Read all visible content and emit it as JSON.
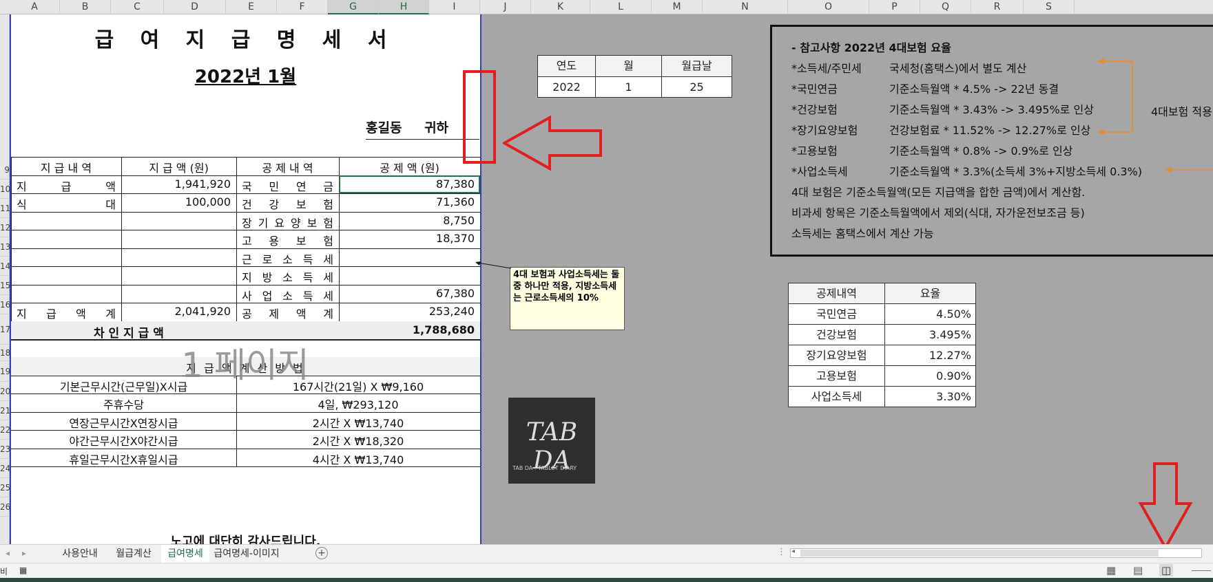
{
  "columns": [
    "A",
    "B",
    "C",
    "D",
    "E",
    "F",
    "G",
    "H",
    "I",
    "J",
    "K",
    "L",
    "M",
    "N",
    "O",
    "P",
    "Q",
    "R",
    "S"
  ],
  "rows": [
    "9",
    "10",
    "11",
    "12",
    "13",
    "14",
    "15",
    "16",
    "17",
    "18",
    "19",
    "20",
    "21",
    "22",
    "23",
    "24",
    "25",
    "26"
  ],
  "payslip": {
    "title": "급 여 지 급 명 세 서",
    "period": "2022년 1월",
    "recipient": "홍길동",
    "honorific": "귀하",
    "headers": [
      "지 급 내 역",
      "지 급 액 (원)",
      "공 제 내 역",
      "공 제 액 (원)"
    ],
    "pay_items": [
      {
        "label_chars": [
          "지",
          "급",
          "액"
        ],
        "amount": "1,941,920"
      },
      {
        "label_chars": [
          "식",
          "대"
        ],
        "amount": "100,000"
      }
    ],
    "deductions": [
      {
        "label_chars": [
          "국",
          "민",
          "연",
          "금"
        ],
        "amount": "87,380"
      },
      {
        "label_chars": [
          "건",
          "강",
          "보",
          "험"
        ],
        "amount": "71,360"
      },
      {
        "label_chars": [
          "장",
          "기",
          "요",
          "양",
          "보",
          "험"
        ],
        "amount": "8,750"
      },
      {
        "label_chars": [
          "고",
          "용",
          "보",
          "험"
        ],
        "amount": "18,370"
      },
      {
        "label_chars": [
          "근",
          "로",
          "소",
          "득",
          "세"
        ],
        "amount": ""
      },
      {
        "label_chars": [
          "지",
          "방",
          "소",
          "득",
          "세"
        ],
        "amount": ""
      },
      {
        "label_chars": [
          "사",
          "업",
          "소",
          "득",
          "세"
        ],
        "amount": "67,380"
      }
    ],
    "total_pay_label_chars": [
      "지",
      "급",
      "액",
      "계"
    ],
    "total_pay": "2,041,920",
    "total_deduction_label_chars": [
      "공",
      "제",
      "액",
      "계"
    ],
    "total_deduction": "253,240",
    "net_label": "차 인 지 급 액",
    "net_amount": "1,788,680",
    "watermark": "1 페이지",
    "calc_title": "지 급 액 계 산 방 법",
    "calc_rows": [
      {
        "label": "기본근무시간(근무일)X시급",
        "value": "167시간(21일) X ₩9,160"
      },
      {
        "label": "주휴수당",
        "value": "4일, ₩293,120"
      },
      {
        "label": "연장근무시간X연장시급",
        "value": "2시간 X ₩13,740"
      },
      {
        "label": "야간근무시간X야간시급",
        "value": "2시간 X ₩18,320"
      },
      {
        "label": "휴일근무시간X휴일시급",
        "value": "4시간 X ₩13,740"
      }
    ],
    "footer": "노고에 대단히 감사드립니다."
  },
  "date_table": {
    "headers": [
      "연도",
      "월",
      "월급날"
    ],
    "values": [
      "2022",
      "1",
      "25"
    ]
  },
  "comment": "4대 보험과 사업소득세는 둘 중 하나만 적용, 지방소득세는 근로소득세의 10%",
  "logo": {
    "text": "TAB DA",
    "subtext": "TAB DA : TABLET DIARY"
  },
  "notes": {
    "title": "- 참고사항 2022년 4대보험 요율",
    "lines": [
      {
        "label": "*소득세/주민세",
        "text": "국세청(홈택스)에서 별도 계산"
      },
      {
        "label": "*국민연금",
        "text": "기준소득월액 * 4.5% -> 22년 동결"
      },
      {
        "label": "*건강보험",
        "text": "기준소득월액 * 3.43% -> 3.495%로 인상"
      },
      {
        "label": "*장기요양보험",
        "text": "건강보험료 * 11.52% -> 12.27%로 인상"
      },
      {
        "label": "*고용보험",
        "text": "기준소득월액 * 0.8% -> 0.9%로 인상"
      },
      {
        "label": "*사업소득세",
        "text": "기준소득월액 * 3.3%(소득세 3%+지방소득세 0.3%)"
      }
    ],
    "plain_lines": [
      "4대 보험은 기준소득월액(모든 지급액을 합한 금액)에서 계산함.",
      "비과세 항목은 기준소득월액에서 제외(식대, 자가운전보조금 등)",
      "소득세는 홈택스에서 계산 가능"
    ],
    "side_note": "4대보험 적용"
  },
  "rate_table": {
    "headers": [
      "공제내역",
      "요율"
    ],
    "rows": [
      {
        "name": "국민연금",
        "rate": "4.50%"
      },
      {
        "name": "건강보험",
        "rate": "3.495%"
      },
      {
        "name": "장기요양보험",
        "rate": "12.27%"
      },
      {
        "name": "고용보험",
        "rate": "0.90%"
      },
      {
        "name": "사업소득세",
        "rate": "3.30%"
      }
    ]
  },
  "sheet_tabs": [
    "사용안내",
    "월급계산",
    "급여명세",
    "급여명세-이미지"
  ],
  "active_tab": "급여명세",
  "colors": {
    "accent_red": "#e02020",
    "excel_green": "#217346",
    "page_border": "#2e3fbf",
    "orange": "#f08a24"
  }
}
